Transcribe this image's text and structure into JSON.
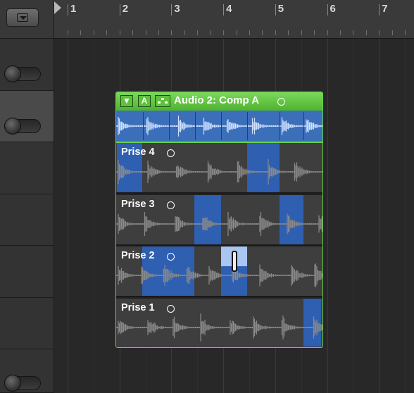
{
  "ruler": {
    "bars": [
      "1",
      "2",
      "3",
      "4",
      "5",
      "6",
      "7"
    ]
  },
  "comp": {
    "name": "Audio 2: Comp A",
    "buttons": {
      "disclosure": "▼",
      "auto": "A"
    }
  },
  "takes": [
    {
      "label": "Prise 4"
    },
    {
      "label": "Prise 3"
    },
    {
      "label": "Prise 2"
    },
    {
      "label": "Prise 1"
    }
  ],
  "colors": {
    "comp_green": "#5dc23c",
    "selection_blue": "#2e5fb0",
    "wave_gray": "#8a8a8a",
    "wave_blue": "#cfe0ff"
  }
}
